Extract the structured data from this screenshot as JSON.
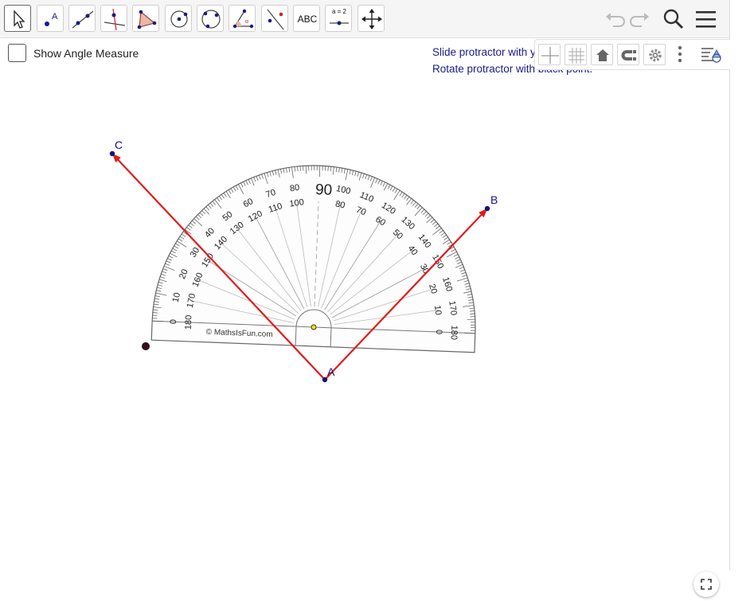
{
  "toolbar": {
    "tools": [
      {
        "name": "move-tool",
        "label": ""
      },
      {
        "name": "point-tool",
        "label": ""
      },
      {
        "name": "line-tool",
        "label": ""
      },
      {
        "name": "perpendicular-line-tool",
        "label": ""
      },
      {
        "name": "polygon-tool",
        "label": ""
      },
      {
        "name": "circle-tool",
        "label": ""
      },
      {
        "name": "circle-through-three-points-tool",
        "label": ""
      },
      {
        "name": "angle-tool",
        "label": ""
      },
      {
        "name": "reflect-tool",
        "label": ""
      },
      {
        "name": "text-tool",
        "label": "ABC"
      },
      {
        "name": "slider-tool",
        "label": "a = 2"
      },
      {
        "name": "move-graphics-view-tool",
        "label": ""
      }
    ],
    "right_icons": [
      "undo-icon",
      "redo-icon",
      "search-icon",
      "menu-icon"
    ]
  },
  "graphics": {
    "checkbox": {
      "label": "Show Angle Measure",
      "checked": false
    },
    "instructions": {
      "line1": "Slide protractor with yellow point.",
      "line2": "Rotate protractor with black point."
    },
    "points": {
      "A": "A",
      "B": "B",
      "C": "C"
    },
    "protractor": {
      "center_label": "90",
      "copyright": "© MathsIsFun.com",
      "major_ticks": [
        "0",
        "10",
        "20",
        "30",
        "40",
        "50",
        "60",
        "70",
        "80",
        "90",
        "100",
        "110",
        "120",
        "130",
        "140",
        "150",
        "160",
        "170",
        "180"
      ]
    }
  },
  "style_bar": {
    "icons": [
      "axes-icon",
      "grid-icon",
      "home-icon",
      "point-capturing-icon",
      "settings-icon",
      "more-icon",
      "toggle-style-bar-icon"
    ]
  },
  "colors": {
    "ray": "#e21b1b",
    "point": "#14147a",
    "accent": "#1a1a8a",
    "protractor_line": "#555555",
    "yellow_point": "#f2e600"
  },
  "fullscreen_icon": "fullscreen-icon"
}
